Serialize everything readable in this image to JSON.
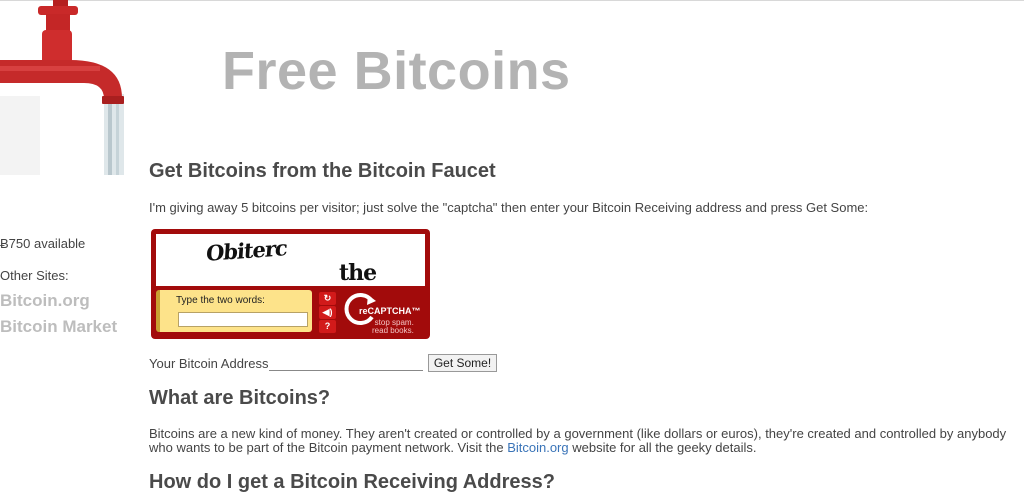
{
  "header": {
    "title": "Free Bitcoins"
  },
  "sidebar": {
    "available": "Ƀ750 available",
    "other_sites_label": "Other Sites:",
    "links": [
      "Bitcoin.org",
      "Bitcoin Market"
    ]
  },
  "main": {
    "heading_get": "Get Bitcoins from the Bitcoin Faucet",
    "intro": "I'm giving away 5 bitcoins per visitor; just solve the \"captcha\" then enter your Bitcoin Receiving address and press Get Some:",
    "address_label": "Your Bitcoin Address:",
    "get_button": "Get Some!",
    "heading_what": "What are Bitcoins?",
    "para_before_link": "Bitcoins are a new kind of money. They aren't created or controlled by a government (like dollars or euros), they're created and controlled by anybody who wants to be part of the Bitcoin payment network. Visit the ",
    "para_link": "Bitcoin.org",
    "para_after_link": " website for all the geeky details.",
    "heading_how": "How do I get a Bitcoin Receiving Address?"
  },
  "captcha": {
    "word1": "Obiterc",
    "word2": "the",
    "prompt": "Type the two words:",
    "brand_prefix": "re",
    "brand": "CAPTCHA™",
    "slogan1": "stop spam.",
    "slogan2": "read books.",
    "icons": [
      "refresh-icon",
      "audio-icon",
      "help-icon"
    ],
    "colors": {
      "frame": "#a20b0b",
      "input_box": "#fde38a"
    }
  }
}
